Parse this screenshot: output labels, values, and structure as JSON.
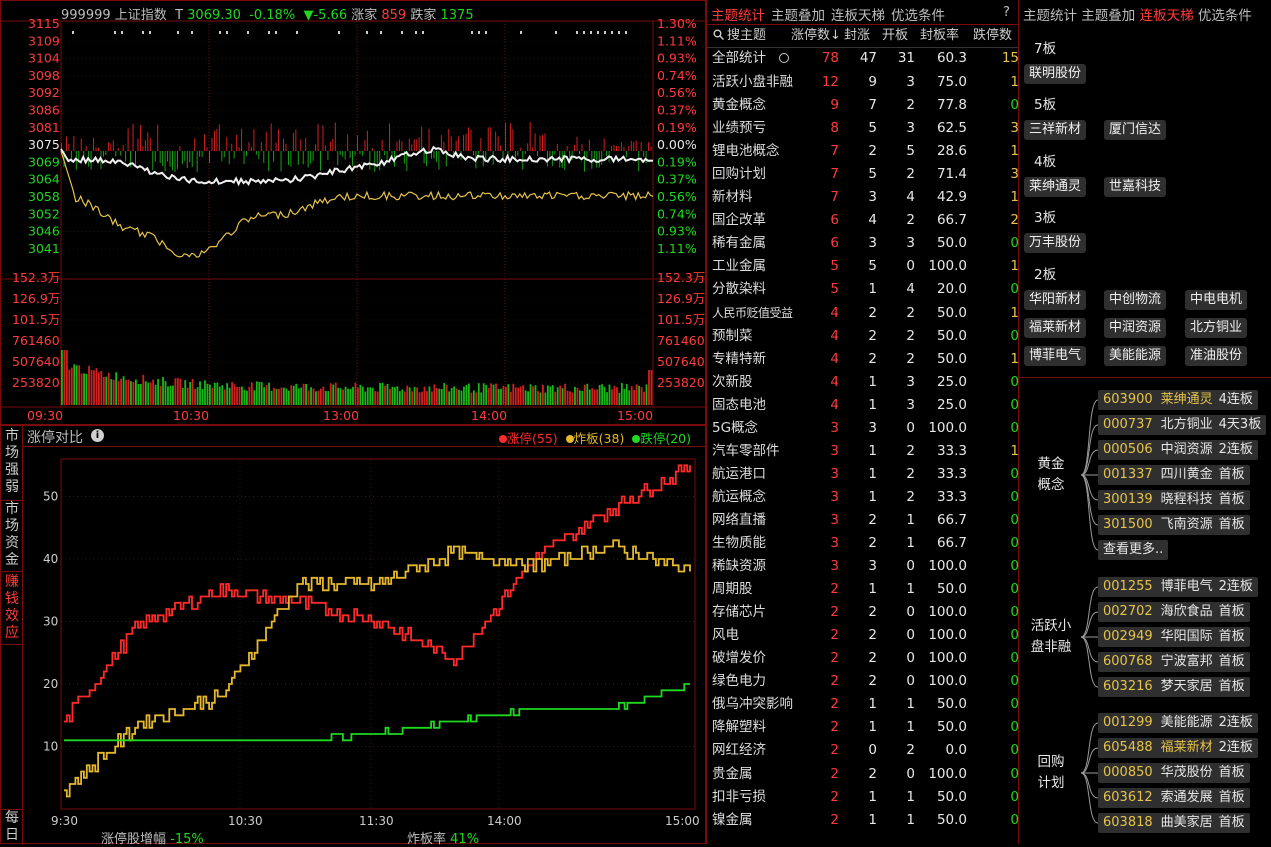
{
  "index_header": {
    "code": "999999",
    "name": "上证指数",
    "t_label": "T",
    "price": "3069.30",
    "pct": "-0.18%",
    "change": "▼-5.66",
    "up_label": "涨家",
    "up_count": "859",
    "down_label": "跌家",
    "down_count": "1375"
  },
  "price_axis_left": [
    "3115",
    "3109",
    "3104",
    "3098",
    "3092",
    "3086",
    "3081",
    "3075",
    "3069",
    "3064",
    "3058",
    "3052",
    "3046",
    "3041"
  ],
  "price_axis_right": [
    "1.30%",
    "1.11%",
    "0.93%",
    "0.74%",
    "0.56%",
    "0.37%",
    "0.19%",
    "0.00%",
    "0.19%",
    "0.37%",
    "0.56%",
    "0.74%",
    "0.93%",
    "1.11%"
  ],
  "volume_axis": [
    "152.3万",
    "126.9万",
    "101.5万",
    "761460",
    "507640",
    "253820"
  ],
  "time_axis": [
    "09:30",
    "10:30",
    "13:00",
    "14:00",
    "15:00"
  ],
  "compare_chart": {
    "title": "涨停对比",
    "legend": [
      {
        "label": "涨停(55)",
        "color": "#ff2a2a"
      },
      {
        "label": "炸板(38)",
        "color": "#e6b82e"
      },
      {
        "label": "跌停(20)",
        "color": "#1fd81f"
      }
    ],
    "y_ticks": [
      "50",
      "40",
      "30",
      "20",
      "10"
    ],
    "x_ticks": [
      "9:30",
      "10:30",
      "11:30",
      "14:00",
      "15:00"
    ],
    "footer_left_label": "涨停股增幅",
    "footer_left_value": "-15%",
    "footer_right_label": "炸板率",
    "footer_right_value": "41%"
  },
  "chart_data": {
    "type": "line",
    "title": "涨停对比",
    "x": [
      "9:30",
      "10:00",
      "10:30",
      "11:00",
      "11:30",
      "13:30",
      "14:00",
      "14:30",
      "15:00"
    ],
    "series": [
      {
        "name": "涨停(55)",
        "color": "#ff2a2a",
        "values": [
          14,
          30,
          35,
          33,
          30,
          24,
          40,
          48,
          55
        ]
      },
      {
        "name": "炸板(38)",
        "color": "#e6b82e",
        "values": [
          3,
          14,
          18,
          36,
          36,
          41,
          39,
          42,
          38
        ]
      },
      {
        "name": "跌停(20)",
        "color": "#1fd81f",
        "values": [
          11,
          11,
          11,
          11,
          12,
          14,
          16,
          16,
          20
        ]
      }
    ],
    "ylim": [
      0,
      56
    ],
    "grid": true,
    "legend_position": "top-right"
  },
  "left_vtabs": [
    "市场强弱",
    "市场资金",
    "赚钱效应",
    "每日"
  ],
  "mid_tabs": [
    "主题统计",
    "主题叠加",
    "连板天梯",
    "优选条件",
    "?"
  ],
  "mid_columns": [
    "搜主题",
    "涨停数↓",
    "封涨",
    "开板",
    "封板率",
    "跌停数"
  ],
  "mid_total": {
    "name": "全部统计",
    "a": "78",
    "b": "47",
    "c": "31",
    "d": "60.3",
    "e": "15"
  },
  "mid_rows": [
    {
      "name": "活跃小盘非融",
      "a": "12",
      "b": "9",
      "c": "3",
      "d": "75.0",
      "e": "1"
    },
    {
      "name": "黄金概念",
      "a": "9",
      "b": "7",
      "c": "2",
      "d": "77.8",
      "e": "0"
    },
    {
      "name": "业绩预亏",
      "a": "8",
      "b": "5",
      "c": "3",
      "d": "62.5",
      "e": "3"
    },
    {
      "name": "锂电池概念",
      "a": "7",
      "b": "2",
      "c": "5",
      "d": "28.6",
      "e": "1"
    },
    {
      "name": "回购计划",
      "a": "7",
      "b": "5",
      "c": "2",
      "d": "71.4",
      "e": "3"
    },
    {
      "name": "新材料",
      "a": "7",
      "b": "3",
      "c": "4",
      "d": "42.9",
      "e": "1"
    },
    {
      "name": "国企改革",
      "a": "6",
      "b": "4",
      "c": "2",
      "d": "66.7",
      "e": "2"
    },
    {
      "name": "稀有金属",
      "a": "6",
      "b": "3",
      "c": "3",
      "d": "50.0",
      "e": "0"
    },
    {
      "name": "工业金属",
      "a": "5",
      "b": "5",
      "c": "0",
      "d": "100.0",
      "e": "1"
    },
    {
      "name": "分散染料",
      "a": "5",
      "b": "1",
      "c": "4",
      "d": "20.0",
      "e": "0"
    },
    {
      "name": "人民币贬值受益",
      "a": "4",
      "b": "2",
      "c": "2",
      "d": "50.0",
      "e": "1"
    },
    {
      "name": "预制菜",
      "a": "4",
      "b": "2",
      "c": "2",
      "d": "50.0",
      "e": "0"
    },
    {
      "name": "专精特新",
      "a": "4",
      "b": "2",
      "c": "2",
      "d": "50.0",
      "e": "1"
    },
    {
      "name": "次新股",
      "a": "4",
      "b": "1",
      "c": "3",
      "d": "25.0",
      "e": "0"
    },
    {
      "name": "固态电池",
      "a": "4",
      "b": "1",
      "c": "3",
      "d": "25.0",
      "e": "0"
    },
    {
      "name": "5G概念",
      "a": "3",
      "b": "3",
      "c": "0",
      "d": "100.0",
      "e": "0"
    },
    {
      "name": "汽车零部件",
      "a": "3",
      "b": "1",
      "c": "2",
      "d": "33.3",
      "e": "1"
    },
    {
      "name": "航运港口",
      "a": "3",
      "b": "1",
      "c": "2",
      "d": "33.3",
      "e": "0"
    },
    {
      "name": "航运概念",
      "a": "3",
      "b": "1",
      "c": "2",
      "d": "33.3",
      "e": "0"
    },
    {
      "name": "网络直播",
      "a": "3",
      "b": "2",
      "c": "1",
      "d": "66.7",
      "e": "0"
    },
    {
      "name": "生物质能",
      "a": "3",
      "b": "2",
      "c": "1",
      "d": "66.7",
      "e": "0"
    },
    {
      "name": "稀缺资源",
      "a": "3",
      "b": "3",
      "c": "0",
      "d": "100.0",
      "e": "0"
    },
    {
      "name": "周期股",
      "a": "2",
      "b": "1",
      "c": "1",
      "d": "50.0",
      "e": "0"
    },
    {
      "name": "存储芯片",
      "a": "2",
      "b": "2",
      "c": "0",
      "d": "100.0",
      "e": "0"
    },
    {
      "name": "风电",
      "a": "2",
      "b": "2",
      "c": "0",
      "d": "100.0",
      "e": "0"
    },
    {
      "name": "破增发价",
      "a": "2",
      "b": "2",
      "c": "0",
      "d": "100.0",
      "e": "0"
    },
    {
      "name": "绿色电力",
      "a": "2",
      "b": "2",
      "c": "0",
      "d": "100.0",
      "e": "0"
    },
    {
      "name": "俄乌冲突影响",
      "a": "2",
      "b": "1",
      "c": "1",
      "d": "50.0",
      "e": "0"
    },
    {
      "name": "降解塑料",
      "a": "2",
      "b": "1",
      "c": "1",
      "d": "50.0",
      "e": "0"
    },
    {
      "name": "网红经济",
      "a": "2",
      "b": "0",
      "c": "2",
      "d": "0.0",
      "e": "0"
    },
    {
      "name": "贵金属",
      "a": "2",
      "b": "2",
      "c": "0",
      "d": "100.0",
      "e": "0"
    },
    {
      "name": "扣非亏损",
      "a": "2",
      "b": "1",
      "c": "1",
      "d": "50.0",
      "e": "0"
    },
    {
      "name": "镍金属",
      "a": "2",
      "b": "1",
      "c": "1",
      "d": "50.0",
      "e": "0"
    }
  ],
  "right_tabs": [
    "主题统计",
    "主题叠加",
    "连板天梯",
    "优选条件"
  ],
  "ladder": {
    "l7": "7板",
    "l7_s": [
      "联明股份"
    ],
    "l5": "5板",
    "l5_s": [
      "三祥新材",
      "厦门信达"
    ],
    "l4": "4板",
    "l4_s": [
      "莱绅通灵",
      "世嘉科技"
    ],
    "l3": "3板",
    "l3_s": [
      "万丰股份"
    ],
    "l2": "2板",
    "l2_s": [
      "华阳新材",
      "中创物流",
      "中电电机",
      "福莱新材",
      "中润资源",
      "北方铜业",
      "博菲电气",
      "美能能源",
      "准油股份"
    ]
  },
  "groups": [
    {
      "name": "黄金概念",
      "items": [
        {
          "code": "603900",
          "name": "莱绅通灵",
          "tag": "4连板",
          "hl": true
        },
        {
          "code": "000737",
          "name": "北方铜业",
          "tag": "4天3板",
          "hl": false
        },
        {
          "code": "000506",
          "name": "中润资源",
          "tag": "2连板",
          "hl": false
        },
        {
          "code": "001337",
          "name": "四川黄金",
          "tag": "首板",
          "hl": false
        },
        {
          "code": "300139",
          "name": "晓程科技",
          "tag": "首板",
          "hl": false
        },
        {
          "code": "301500",
          "name": "飞南资源",
          "tag": "首板",
          "hl": false
        }
      ],
      "more": "查看更多.."
    },
    {
      "name": "活跃小盘非融",
      "items": [
        {
          "code": "001255",
          "name": "博菲电气",
          "tag": "2连板",
          "hl": false
        },
        {
          "code": "002702",
          "name": "海欣食品",
          "tag": "首板",
          "hl": false
        },
        {
          "code": "002949",
          "name": "华阳国际",
          "tag": "首板",
          "hl": false
        },
        {
          "code": "600768",
          "name": "宁波富邦",
          "tag": "首板",
          "hl": false
        },
        {
          "code": "603216",
          "name": "梦天家居",
          "tag": "首板",
          "hl": false
        }
      ]
    },
    {
      "name": "回购计划",
      "items": [
        {
          "code": "001299",
          "name": "美能能源",
          "tag": "2连板",
          "hl": false
        },
        {
          "code": "605488",
          "name": "福莱新材",
          "tag": "2连板",
          "hl": true
        },
        {
          "code": "000850",
          "name": "华茂股份",
          "tag": "首板",
          "hl": false
        },
        {
          "code": "603612",
          "name": "索通发展",
          "tag": "首板",
          "hl": false
        },
        {
          "code": "603818",
          "name": "曲美家居",
          "tag": "首板",
          "hl": false
        }
      ]
    }
  ]
}
